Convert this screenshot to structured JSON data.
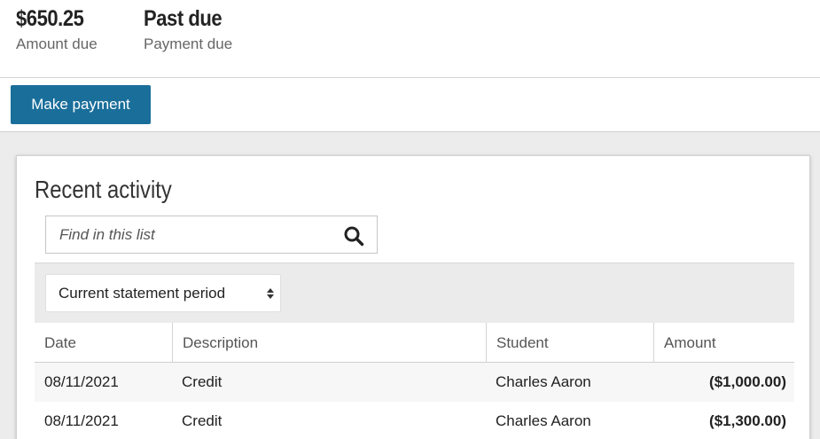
{
  "summary": {
    "amount_due_value": "$650.25",
    "amount_due_label": "Amount due",
    "payment_due_value": "Past due",
    "payment_due_label": "Payment due"
  },
  "actions": {
    "make_payment_label": "Make payment"
  },
  "recent_activity": {
    "title": "Recent activity",
    "search": {
      "placeholder": "Find in this list",
      "value": ""
    },
    "period_filter": {
      "selected": "Current statement period"
    },
    "columns": [
      "Date",
      "Description",
      "Student",
      "Amount"
    ],
    "rows": [
      {
        "date": "08/11/2021",
        "description": "Credit",
        "student": "Charles Aaron",
        "amount": "($1,000.00)"
      },
      {
        "date": "08/11/2021",
        "description": "Credit",
        "student": "Charles Aaron",
        "amount": "($1,300.00)"
      }
    ]
  },
  "colors": {
    "accent": "#1a6e9a",
    "page_background": "#ececec",
    "filter_band": "#ebebeb"
  },
  "icons": {
    "search": "search-icon",
    "select": "up-down-arrows-icon"
  }
}
